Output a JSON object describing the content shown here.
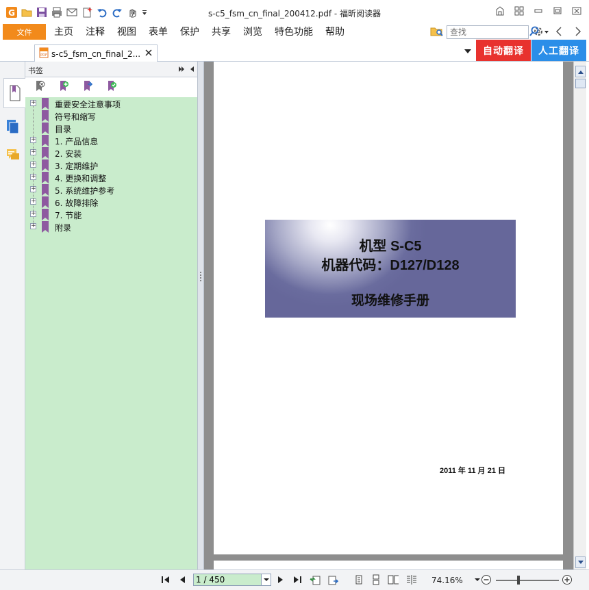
{
  "window": {
    "title": "s-c5_fsm_cn_final_200412.pdf - 福昕阅读器"
  },
  "quick_access": [
    "app-logo-icon",
    "open-icon",
    "save-icon",
    "print-icon",
    "email-icon",
    "new-icon",
    "undo-icon",
    "redo-icon",
    "hand-tool-icon",
    "customize-dropdown-icon"
  ],
  "menu": {
    "file": "文件",
    "items": [
      "主页",
      "注释",
      "视图",
      "表单",
      "保护",
      "共享",
      "浏览",
      "特色功能",
      "帮助"
    ]
  },
  "search": {
    "placeholder": "查找"
  },
  "tab": {
    "label": "s-c5_fsm_cn_final_2..."
  },
  "translate": {
    "auto": "自动翻译",
    "human": "人工翻译"
  },
  "bookmarks": {
    "title": "书签",
    "items": [
      {
        "label": "重要安全注意事项",
        "expandable": true
      },
      {
        "label": "符号和缩写",
        "expandable": false
      },
      {
        "label": "目录",
        "expandable": false
      },
      {
        "label": "1. 产品信息",
        "expandable": true
      },
      {
        "label": "2. 安装",
        "expandable": true
      },
      {
        "label": "3. 定期维护",
        "expandable": true
      },
      {
        "label": "4. 更换和调整",
        "expandable": true
      },
      {
        "label": "5. 系统维护参考",
        "expandable": true
      },
      {
        "label": "6. 故障排除",
        "expandable": true
      },
      {
        "label": "7. 节能",
        "expandable": true
      },
      {
        "label": "附录",
        "expandable": true
      }
    ]
  },
  "document": {
    "cover_line1": "机型 S-C5",
    "cover_line2": "机器代码：D127/D128",
    "cover_line3": "现场维修手册",
    "date": "2011 年 11 月 21 日"
  },
  "status": {
    "page": "1 / 450",
    "zoom": "74.16%"
  },
  "colors": {
    "file_button": "#f28a1b",
    "auto_translate": "#e8322e",
    "human_translate": "#2b8ee8",
    "bookmark_panel": "#c9eccc",
    "bookmark_flag": "#8e5aa0",
    "doc_background": "#8e8e8e"
  }
}
